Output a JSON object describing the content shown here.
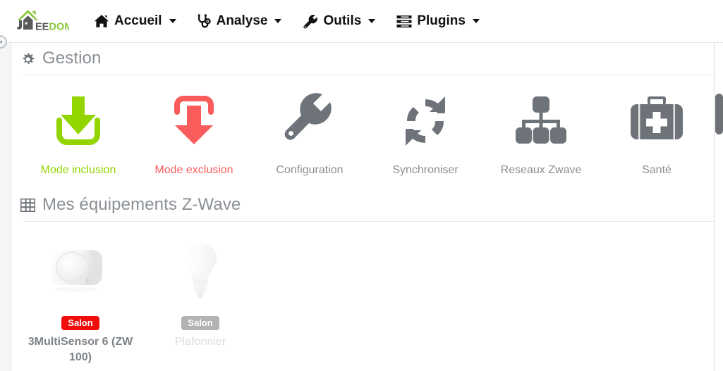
{
  "brand": {
    "name": "JEEDOM",
    "text_dark": "EE",
    "text_green": "DOM",
    "logo_icon": "house-logo-icon",
    "colors": {
      "green": "#8cc63e",
      "dark": "#58595b"
    }
  },
  "navbar": {
    "items": [
      {
        "label": "Accueil",
        "icon": "home-icon",
        "has_caret": true
      },
      {
        "label": "Analyse",
        "icon": "stethoscope-icon",
        "has_caret": true
      },
      {
        "label": "Outils",
        "icon": "wrench-icon",
        "has_caret": true
      },
      {
        "label": "Plugins",
        "icon": "server-list-icon",
        "has_caret": true
      }
    ]
  },
  "sidebar": {
    "toggle_icon": "collapse-toggle-icon"
  },
  "gestion": {
    "title": "Gestion",
    "icon": "gear-icon",
    "tiles": [
      {
        "label": "Mode inclusion",
        "icon": "inbox-download-icon",
        "color": "#93d500",
        "style": "green"
      },
      {
        "label": "Mode exclusion",
        "icon": "export-arrow-icon",
        "color": "#fa5c5c",
        "style": "red"
      },
      {
        "label": "Configuration",
        "icon": "wrench-icon",
        "color": "#8a8f94",
        "style": "grey"
      },
      {
        "label": "Synchroniser",
        "icon": "refresh-icon",
        "color": "#8a8f94",
        "style": "grey"
      },
      {
        "label": "Reseaux Zwave",
        "icon": "sitemap-icon",
        "color": "#8a8f94",
        "style": "grey"
      },
      {
        "label": "Santé",
        "icon": "medkit-icon",
        "color": "#8a8f94",
        "style": "grey"
      }
    ]
  },
  "equipements": {
    "title": "Mes équipements Z-Wave",
    "icon": "table-grid-icon",
    "devices": [
      {
        "name": "3MultiSensor 6 (ZW 100)",
        "room_badge": "Salon",
        "badge_color": "#f20d0d",
        "image": "multisensor-device-image",
        "active": true
      },
      {
        "name": "Plafonnier",
        "room_badge": "Salon",
        "badge_color": "#b3b3b3",
        "image": "light-bulb-device-image",
        "active": false
      }
    ]
  },
  "scrollbar": {
    "name": "vertical-scrollbar"
  }
}
